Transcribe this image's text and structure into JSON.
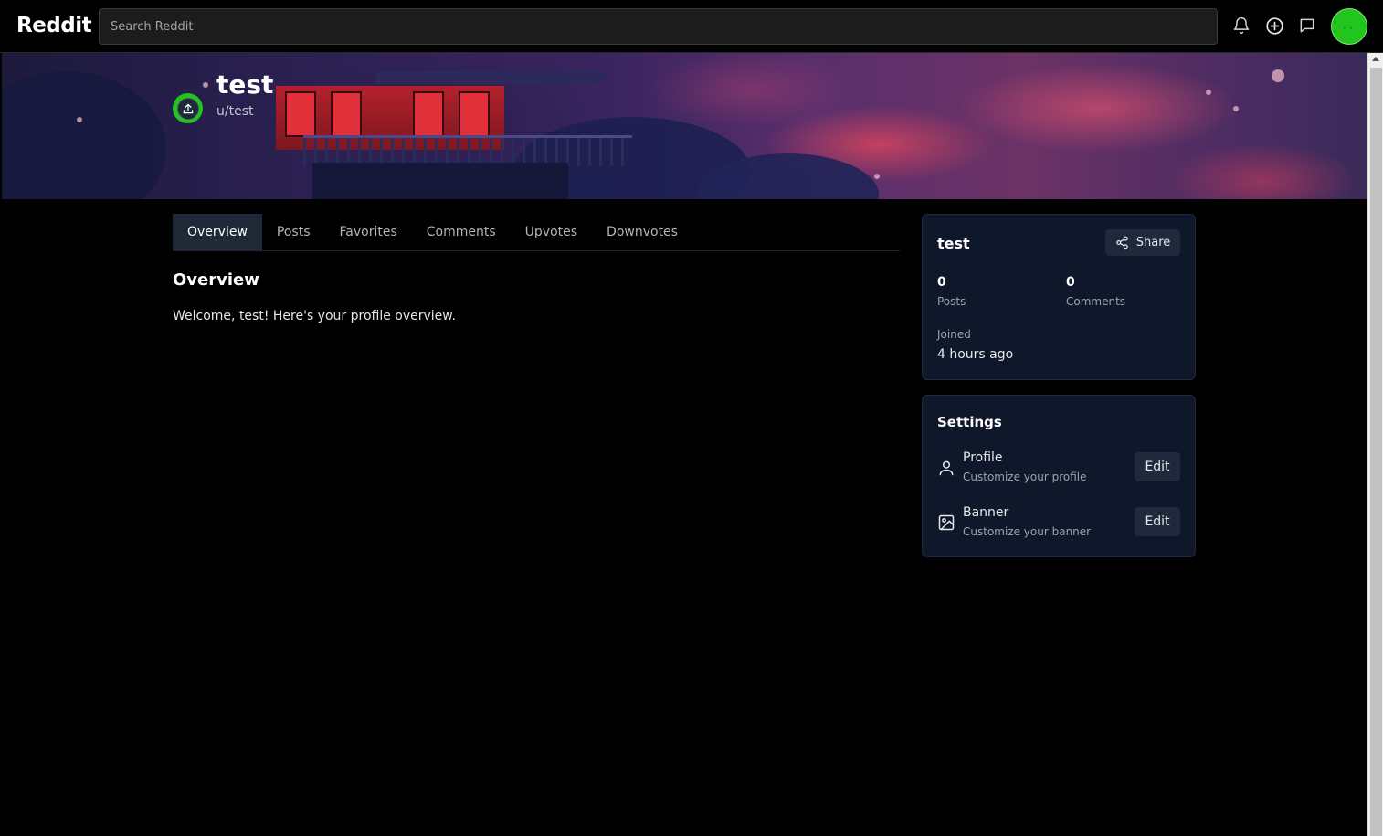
{
  "header": {
    "logo": "Reddit",
    "search_placeholder": "Search Reddit",
    "icons": [
      "bell-icon",
      "plus-circle-icon",
      "chat-icon"
    ],
    "avatar_color": "#22c51e"
  },
  "profile": {
    "name": "test",
    "handle": "u/test",
    "avatar_color": "#22c51e"
  },
  "tabs": [
    {
      "label": "Overview",
      "active": true
    },
    {
      "label": "Posts",
      "active": false
    },
    {
      "label": "Favorites",
      "active": false
    },
    {
      "label": "Comments",
      "active": false
    },
    {
      "label": "Upvotes",
      "active": false
    },
    {
      "label": "Downvotes",
      "active": false
    }
  ],
  "main": {
    "title": "Overview",
    "welcome": "Welcome, test! Here's your profile overview."
  },
  "sidebar": {
    "user_card": {
      "title": "test",
      "share_label": "Share",
      "posts_count": "0",
      "posts_label": "Posts",
      "comments_count": "0",
      "comments_label": "Comments",
      "joined_label": "Joined",
      "joined_value": "4 hours ago"
    },
    "settings": {
      "title": "Settings",
      "items": [
        {
          "name": "Profile",
          "desc": "Customize your profile",
          "action": "Edit",
          "icon": "user-icon"
        },
        {
          "name": "Banner",
          "desc": "Customize your banner",
          "action": "Edit",
          "icon": "image-icon"
        }
      ]
    }
  }
}
